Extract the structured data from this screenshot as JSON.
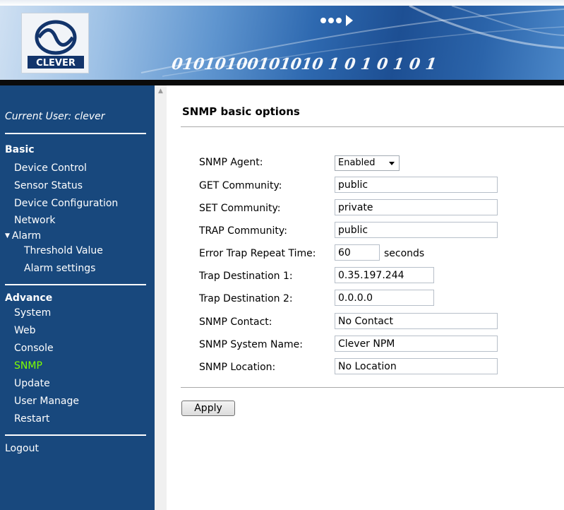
{
  "header": {
    "logo_text": "CLEVER",
    "binary_text": "01010100101010 1 0 1 0 1 0 1",
    "colors": {
      "banner_dark": "#1d4f93",
      "banner_light": "#cfe0f2",
      "bottom_bar": "#0b0b0b"
    }
  },
  "sidebar": {
    "current_user": "Current User: clever",
    "basic_title": "Basic",
    "basic_items": [
      "Device Control",
      "Sensor Status",
      "Device Configuration",
      "Network"
    ],
    "alarm_label": "Alarm",
    "alarm_sub": [
      "Threshold Value",
      "Alarm settings"
    ],
    "advance_title": "Advance",
    "advance_items": [
      "System",
      "Web",
      "Console",
      "SNMP",
      "Update",
      "User Manage",
      "Restart"
    ],
    "active_item": "SNMP",
    "logout": "Logout",
    "colors": {
      "background": "#18487d",
      "text": "#ffffff",
      "active": "#7fff00"
    }
  },
  "main": {
    "title": "SNMP basic options",
    "agent": {
      "label": "SNMP Agent:",
      "value": "Enabled"
    },
    "get_community": {
      "label": "GET Community:",
      "value": "public"
    },
    "set_community": {
      "label": "SET Community:",
      "value": "private"
    },
    "trap_community": {
      "label": "TRAP Community:",
      "value": "public"
    },
    "error_trap": {
      "label": "Error Trap Repeat Time:",
      "value": "60",
      "unit": "seconds"
    },
    "trap_dest_1": {
      "label": "Trap Destination 1:",
      "value": "0.35.197.244"
    },
    "trap_dest_2": {
      "label": "Trap Destination 2:",
      "value": "0.0.0.0"
    },
    "contact": {
      "label": "SNMP Contact:",
      "value": "No Contact"
    },
    "system_name": {
      "label": "SNMP System Name:",
      "value": "Clever NPM"
    },
    "location": {
      "label": "SNMP Location:",
      "value": "No Location"
    },
    "apply_label": "Apply"
  }
}
